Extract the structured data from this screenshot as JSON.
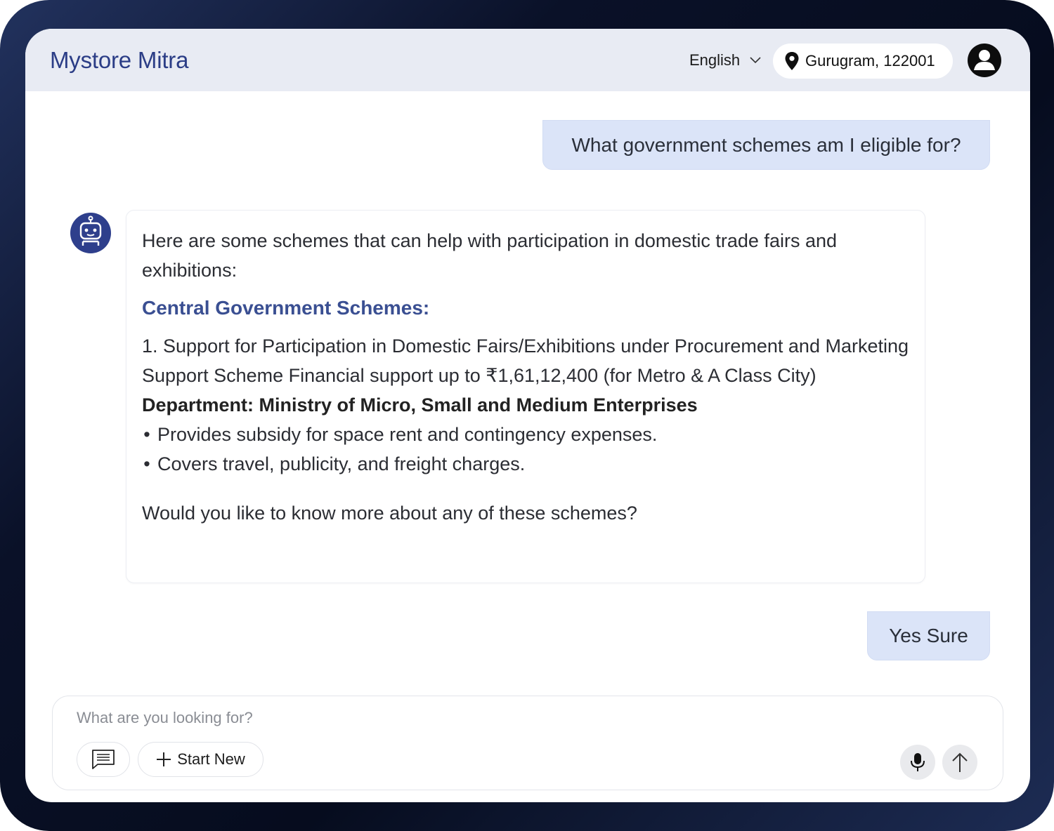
{
  "header": {
    "brand": "Mystore Mitra",
    "language": "English",
    "location": "Gurugram, 122001",
    "icons": [
      "chevron-down-icon",
      "map-pin-icon",
      "user-avatar-icon"
    ]
  },
  "messages": {
    "user_question": "What government schemes am I eligible for?",
    "bot_reply": {
      "intro": "Here are some schemes that can help with participation in domestic trade fairs and exhibitions:",
      "section_title": "Central Government Schemes:",
      "scheme_line": "1. Support for Participation in Domestic Fairs/Exhibitions under Procurement and Marketing Support Scheme Financial support up to ₹1,61,12,400 (for Metro & A Class City)",
      "department": "Department: Ministry of Micro, Small and Medium Enterprises",
      "bullets": [
        "Provides subsidy for space rent and contingency expenses.",
        "Covers travel, publicity, and freight charges."
      ],
      "closing": "Would you like to know more about any of these schemes?"
    },
    "user_reply": "Yes Sure"
  },
  "composer": {
    "placeholder": "What are you looking for?",
    "start_new_label": "Start New",
    "icons": [
      "chat-icon",
      "plus-icon",
      "microphone-icon",
      "arrow-up-icon"
    ]
  },
  "colors": {
    "brand": "#2b3d86",
    "header_bg": "#e8ebf3",
    "user_bubble": "#dbe4f8",
    "section_title": "#3a4f92",
    "bot_avatar": "#2e3f8c"
  }
}
